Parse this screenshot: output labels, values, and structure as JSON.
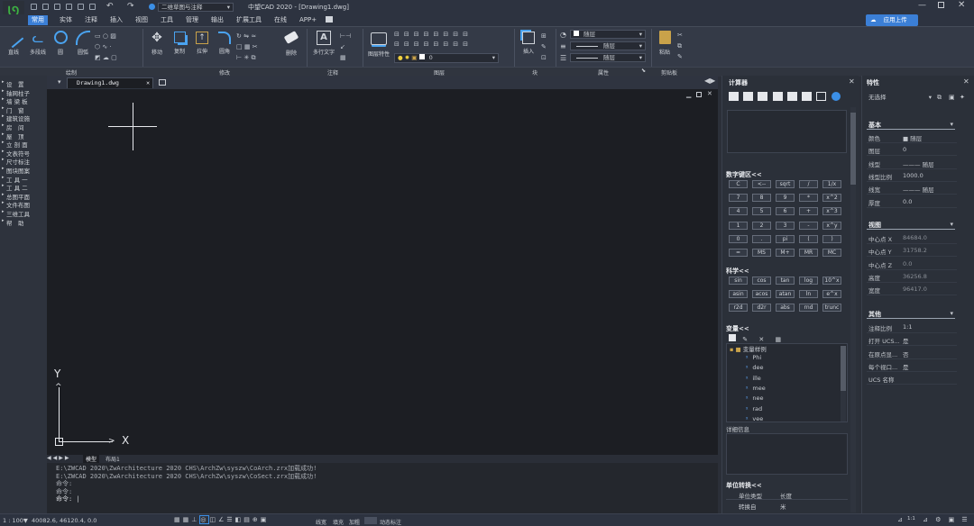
{
  "title_bar": {
    "app_title": "中望CAD 2020 - [Drawing1.dwg]",
    "workspace": "二维草图与注释"
  },
  "menu": {
    "items": [
      "常用",
      "实体",
      "注释",
      "插入",
      "视图",
      "工具",
      "管理",
      "输出",
      "扩展工具",
      "在线",
      "APP+"
    ],
    "active": "常用",
    "cloud_button": "应用上传"
  },
  "ribbon": {
    "draw_tools": [
      "直线",
      "多段线",
      "圆",
      "圆弧"
    ],
    "modify_tools": [
      "移动",
      "复制",
      "拉伸",
      "圆角",
      "删除"
    ],
    "annotate_tools": [
      "多行文字"
    ],
    "layer_tools": [
      "图层特性"
    ],
    "block_tools": [
      "插入"
    ],
    "paste_tools": [
      "粘贴"
    ],
    "layer_value": "0",
    "prop_color": "随层",
    "prop_linetype": "随层",
    "prop_lineweight": "随层",
    "groups": [
      "绘制",
      "修改",
      "注释",
      "图层",
      "块",
      "属性",
      "剪贴板"
    ]
  },
  "left_panel": {
    "items": [
      "设　置",
      "轴网柱子",
      "墙 梁 板",
      "门　窗",
      "建筑设施",
      "房　间",
      "屋　顶",
      "立 剖 面",
      "文表符号",
      "尺寸标注",
      "图块图案",
      "工 具 一",
      "工 具 二",
      "总图平面",
      "文件布图",
      "三维工具",
      "帮　助"
    ]
  },
  "document": {
    "tab": "Drawing1.dwg",
    "layout_tabs": [
      "模型",
      "布局1"
    ]
  },
  "axes": {
    "x": "X",
    "y": "Y"
  },
  "command": {
    "lines": [
      "E:\\ZWCAD 2020\\ZwArchitecture 2020 CHS\\ArchZw\\syszw\\CoArch.zrx加载成功!",
      "E:\\ZWCAD 2020\\ZwArchitecture 2020 CHS\\ArchZw\\syszw\\CoSect.zrx加载成功!",
      "命令:",
      "命令:",
      "命令: |"
    ]
  },
  "status": {
    "scale": "1 : 100▼",
    "coords": "40082.6, 46120.4, 0.0",
    "toggles": [
      "线宽",
      "填充",
      "加粗",
      "动态标注"
    ],
    "badge": "1:1"
  },
  "calculator": {
    "title": "计算器",
    "numpad_header": "数字键区<<",
    "numpad": [
      [
        "C",
        "<--",
        "sqrt",
        "/",
        "1/x"
      ],
      [
        "7",
        "8",
        "9",
        "*",
        "x^2"
      ],
      [
        "4",
        "5",
        "6",
        "+",
        "x^3"
      ],
      [
        "1",
        "2",
        "3",
        "-",
        "x^y"
      ],
      [
        "0",
        ".",
        "pi",
        "(",
        ")"
      ],
      [
        "=",
        "MS",
        "M+",
        "MR",
        "MC"
      ]
    ],
    "sci_header": "科学<<",
    "sci": [
      [
        "sin",
        "cos",
        "tan",
        "log",
        "10^x"
      ],
      [
        "asin",
        "acos",
        "atan",
        "ln",
        "e^x"
      ],
      [
        "r2d",
        "d2r",
        "abs",
        "rnd",
        "trunc"
      ]
    ],
    "var_header": "变量<<",
    "var_folder": "变量样例",
    "variables": [
      "Phi",
      "dee",
      "ille",
      "mee",
      "nee",
      "rad",
      "vee"
    ],
    "details_label": "详细信息",
    "unit_header": "单位转换<<",
    "unit_type_label": "单位类型",
    "unit_type_value": "长度",
    "convert_from_label": "转换自",
    "convert_from_value": "米"
  },
  "properties": {
    "title": "特性",
    "selection": "无选择",
    "basic_header": "基本",
    "basic": [
      {
        "k": "颜色",
        "v": "■ 随层"
      },
      {
        "k": "图层",
        "v": "0"
      },
      {
        "k": "线型",
        "v": "——— 随层"
      },
      {
        "k": "线型比例",
        "v": "1000.0"
      },
      {
        "k": "线宽",
        "v": "——— 随层"
      },
      {
        "k": "厚度",
        "v": "0.0"
      }
    ],
    "view_header": "视图",
    "view": [
      {
        "k": "中心点 X",
        "v": "84684.0"
      },
      {
        "k": "中心点 Y",
        "v": "31758.2"
      },
      {
        "k": "中心点 Z",
        "v": "0.0"
      },
      {
        "k": "高度",
        "v": "36256.8"
      },
      {
        "k": "宽度",
        "v": "96417.0"
      }
    ],
    "other_header": "其他",
    "other": [
      {
        "k": "注释比例",
        "v": "1:1"
      },
      {
        "k": "打开 UCS...",
        "v": "是"
      },
      {
        "k": "在原点显...",
        "v": "否"
      },
      {
        "k": "每个视口...",
        "v": "是"
      },
      {
        "k": "UCS 名称",
        "v": ""
      }
    ]
  }
}
